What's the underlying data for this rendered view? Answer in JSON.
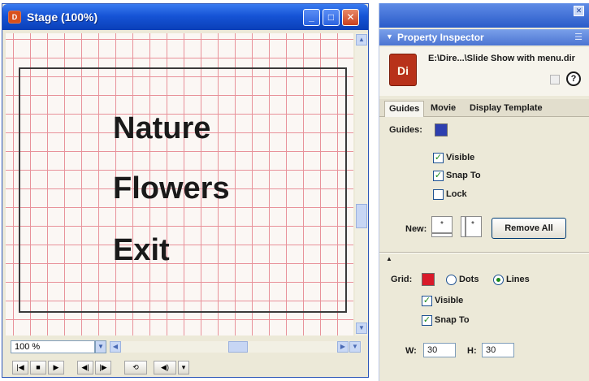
{
  "stage": {
    "title": "Stage (100%)",
    "menu_items": [
      "Nature",
      "Flowers",
      "Exit"
    ],
    "zoom_value": "100 %",
    "controls": {
      "rewind": "|◀",
      "stop": "■",
      "play": "▶",
      "step_back": "◀|",
      "step_forward": "|▶",
      "loop": "⟲",
      "volume": "◀)",
      "extra": "▾"
    }
  },
  "inspector": {
    "title": "Property Inspector",
    "file_path": "E:\\Dire...\\Slide Show with menu.dir",
    "doc_icon_text": "Di",
    "tabs": [
      "Guides",
      "Movie",
      "Display Template"
    ],
    "guides": {
      "label": "Guides:",
      "color": "#2d3fb0",
      "options": [
        {
          "label": "Visible",
          "checked": true
        },
        {
          "label": "Snap To",
          "checked": true
        },
        {
          "label": "Lock",
          "checked": false
        }
      ],
      "new_label": "New:",
      "remove_all_label": "Remove All"
    },
    "grid": {
      "label": "Grid:",
      "color": "#d91a2a",
      "radio_dots": "Dots",
      "radio_lines": "Lines",
      "selected": "Lines",
      "options": [
        {
          "label": "Visible",
          "checked": true
        },
        {
          "label": "Snap To",
          "checked": true
        }
      ],
      "w_label": "W:",
      "w_value": "30",
      "h_label": "H:",
      "h_value": "30"
    }
  },
  "colors": {
    "title_blue": "#1654d6",
    "grid_line": "#e8929a",
    "panel_bg": "#ece9d8"
  }
}
